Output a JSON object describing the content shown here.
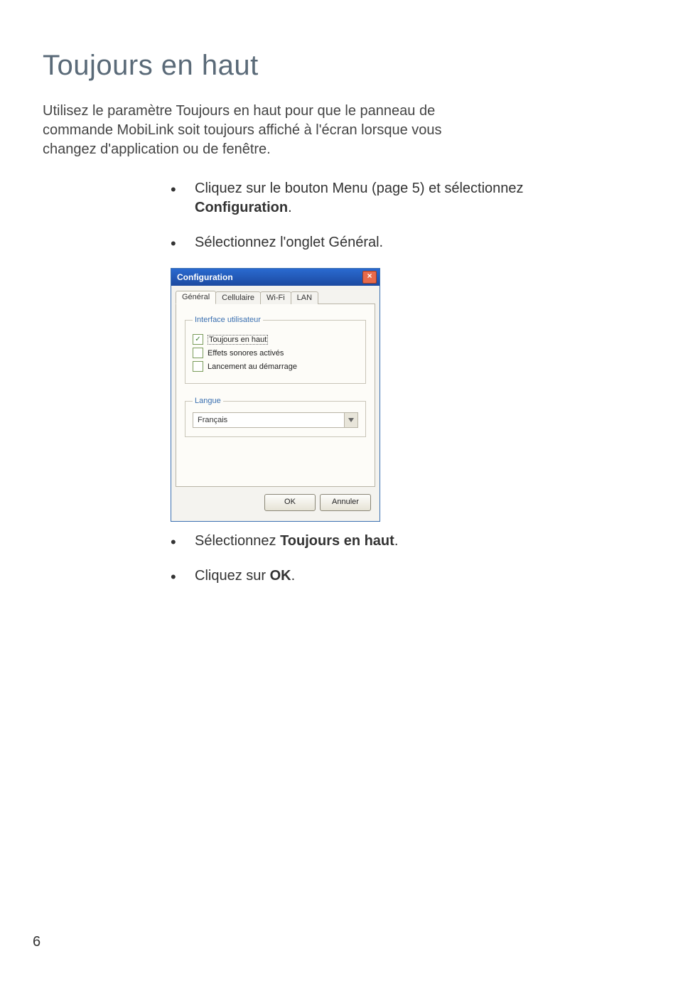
{
  "page_title": "Toujours en haut",
  "intro": "Utilisez le paramètre Toujours en haut pour que le panneau de commande MobiLink soit toujours affiché à l'écran lorsque vous changez d'application ou de fenêtre.",
  "steps": {
    "step1_prefix": "Cliquez sur le bouton Menu (page 5) et sélectionnez ",
    "step1_bold": "Configuration",
    "step1_suffix": ".",
    "step2": "Sélectionnez l'onglet Général.",
    "step3_prefix": "Sélectionnez ",
    "step3_bold": "Toujours en haut",
    "step3_suffix": ".",
    "step4_prefix": "Cliquez sur ",
    "step4_bold": "OK",
    "step4_suffix": "."
  },
  "dialog": {
    "title": "Configuration",
    "close_glyph": "×",
    "tabs": [
      "Général",
      "Cellulaire",
      "Wi-Fi",
      "LAN"
    ],
    "active_tab_index": 0,
    "group_ui_legend": "Interface utilisateur",
    "checkboxes": [
      {
        "label": "Toujours en haut",
        "checked": true,
        "focused": true
      },
      {
        "label": "Effets sonores activés",
        "checked": false,
        "focused": false
      },
      {
        "label": "Lancement au démarrage",
        "checked": false,
        "focused": false
      }
    ],
    "group_lang_legend": "Langue",
    "language_value": "Français",
    "ok_label": "OK",
    "cancel_label": "Annuler"
  },
  "page_number": "6"
}
